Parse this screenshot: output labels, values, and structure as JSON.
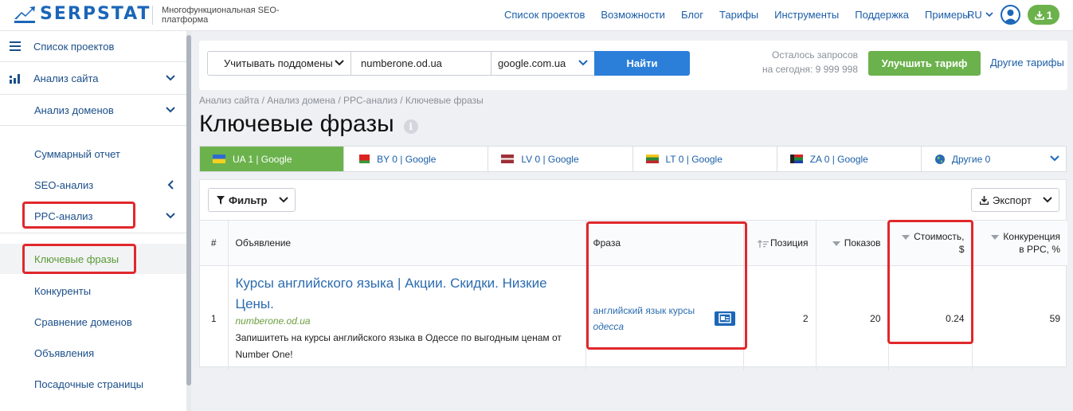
{
  "header": {
    "logo_text": "SERPSTAT",
    "tagline": "Многофункциональная SEO-платформа",
    "nav": [
      "Список проектов",
      "Возможности",
      "Блог",
      "Тарифы",
      "Инструменты",
      "Поддержка",
      "Примеры"
    ],
    "lang": "RU",
    "downloads_count": "1"
  },
  "sidebar": {
    "projects": "Список проектов",
    "site_analysis": "Анализ сайта",
    "domain_analysis": "Анализ доменов",
    "items": [
      "Суммарный отчет",
      "SEO-анализ",
      "PPC-анализ",
      "Ключевые фразы",
      "Конкуренты",
      "Сравнение доменов",
      "Объявления",
      "Посадочные страницы"
    ]
  },
  "search": {
    "subdomains_label": "Учитывать поддомены",
    "domain_value": "numberone.od.ua",
    "engine_value": "google.com.ua",
    "find_label": "Найти",
    "quota_line1": "Осталось запросов",
    "quota_line2": "на сегодня: 9 999 998",
    "upgrade_label": "Улучшить тариф",
    "other_plans": "Другие тарифы"
  },
  "breadcrumbs": "Анализ сайта / Анализ домена / PPC-анализ / Ключевые фразы",
  "page_title": "Ключевые фразы",
  "tabs": [
    {
      "label": "UA 1 | Google",
      "active": true
    },
    {
      "label": "BY 0 | Google"
    },
    {
      "label": "LV 0 | Google"
    },
    {
      "label": "LT 0 | Google"
    },
    {
      "label": "ZA 0 | Google"
    },
    {
      "label": "Другие 0"
    }
  ],
  "toolbar": {
    "filter_label": "Фильтр",
    "export_label": "Экспорт"
  },
  "table": {
    "headers": {
      "num": "#",
      "ad": "Объявление",
      "phrase": "Фраза",
      "position": "Позиция",
      "impressions": "Показов",
      "cost_line1": "Стоимость,",
      "cost_line2": "$",
      "competition_line1": "Конкуренция",
      "competition_line2": "в PPC, %"
    },
    "rows": [
      {
        "num": "1",
        "ad_title": "Курсы английского языка | Акции. Скидки. Низкие Цены.",
        "ad_url": "numberone.od.ua",
        "ad_desc": "Запишитеть на курсы английского языка в Одессе по выгодным ценам от Number One!",
        "phrase_line1": "английский язык курсы",
        "phrase_line2": "одесса",
        "position": "2",
        "impressions": "20",
        "cost": "0.24",
        "competition": "59"
      }
    ]
  },
  "colors": {
    "brand_blue": "#1b66b8",
    "accent_green": "#6bb24c",
    "highlight_red": "#e0282c"
  }
}
